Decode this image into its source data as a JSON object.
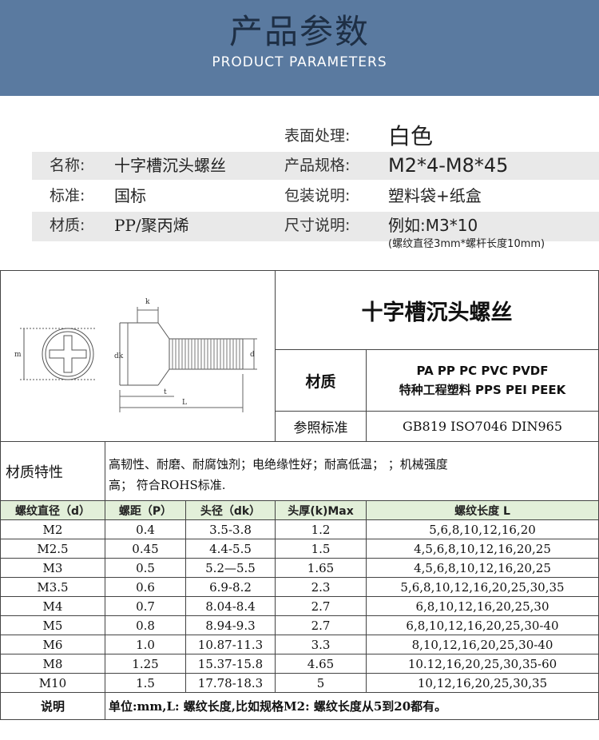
{
  "header": {
    "title": "产品参数",
    "subtitle": "PRODUCT PARAMETERS"
  },
  "info": [
    {
      "label1": "",
      "value1": "",
      "label2": "表面处理:",
      "value2": "白色"
    },
    {
      "label1": "名称:",
      "value1": "十字槽沉头螺丝",
      "label2": "产品规格:",
      "value2": "M2*4-M8*45"
    },
    {
      "label1": "标准:",
      "value1": "国标",
      "label2": "包装说明:",
      "value2": "塑料袋+纸盒"
    },
    {
      "label1": "材质:",
      "value1": "PP/聚丙烯",
      "label2": "尺寸说明:",
      "value2": "例如:M3*10"
    }
  ],
  "size_note": "(螺纹直径3mm*螺杆长度10mm)",
  "diagram": {
    "m": "m",
    "k": "k",
    "dk": "dk",
    "d": "d",
    "t": "t",
    "L": "L"
  },
  "product_name": "十字槽沉头螺丝",
  "material_label": "材质",
  "material_values": [
    "PA PP PC PVC  PVDF",
    "特种工程塑料 PPS PEI  PEEK"
  ],
  "standard_label": "参照标准",
  "standard_value": "GB819  ISO7046  DIN965",
  "properties_label": "材质特性",
  "properties_line1": "高韧性、耐磨、耐腐蚀剂；电绝缘性好；耐高低温；              ；机械强度",
  "properties_line2": "高；             符合ROHS标准.",
  "table": {
    "headers": [
      "螺纹直径（d）",
      "螺距（P）",
      "头径（dk）",
      "头厚(k)Max",
      "螺纹长度 L"
    ],
    "rows": [
      [
        "M2",
        "0.4",
        "3.5-3.8",
        "1.2",
        "5,6,8,10,12,16,20"
      ],
      [
        "M2.5",
        "0.45",
        "4.4-5.5",
        "1.5",
        "4,5,6,8,10,12,16,20,25"
      ],
      [
        "M3",
        "0.5",
        "5.2—5.5",
        "1.65",
        "4,5,6,8,10,12,16,20,25"
      ],
      [
        "M3.5",
        "0.6",
        "6.9-8.2",
        "2.3",
        "5,6,8,10,12,16,20,25,30,35"
      ],
      [
        "M4",
        "0.7",
        "8.04-8.4",
        "2.7",
        "6,8,10,12,16,20,25,30"
      ],
      [
        "M5",
        "0.8",
        "8.94-9.3",
        "2.7",
        "6,8,10,12,16,20,25,30-40"
      ],
      [
        "M6",
        "1.0",
        "10.87-11.3",
        "3.3",
        "8,10,12,16,20,25,30-40"
      ],
      [
        "M8",
        "1.25",
        "15.37-15.8",
        "4.65",
        "10.12,16,20,25,30,35-60"
      ],
      [
        "M10",
        "1.5",
        "17.78-18.3",
        "5",
        "10,12,16,20,25,30,35"
      ]
    ],
    "footer_label": "说明",
    "footer_text": "单位:mm,L: 螺纹长度,比如规格M2: 螺纹长度从5到20都有。"
  }
}
